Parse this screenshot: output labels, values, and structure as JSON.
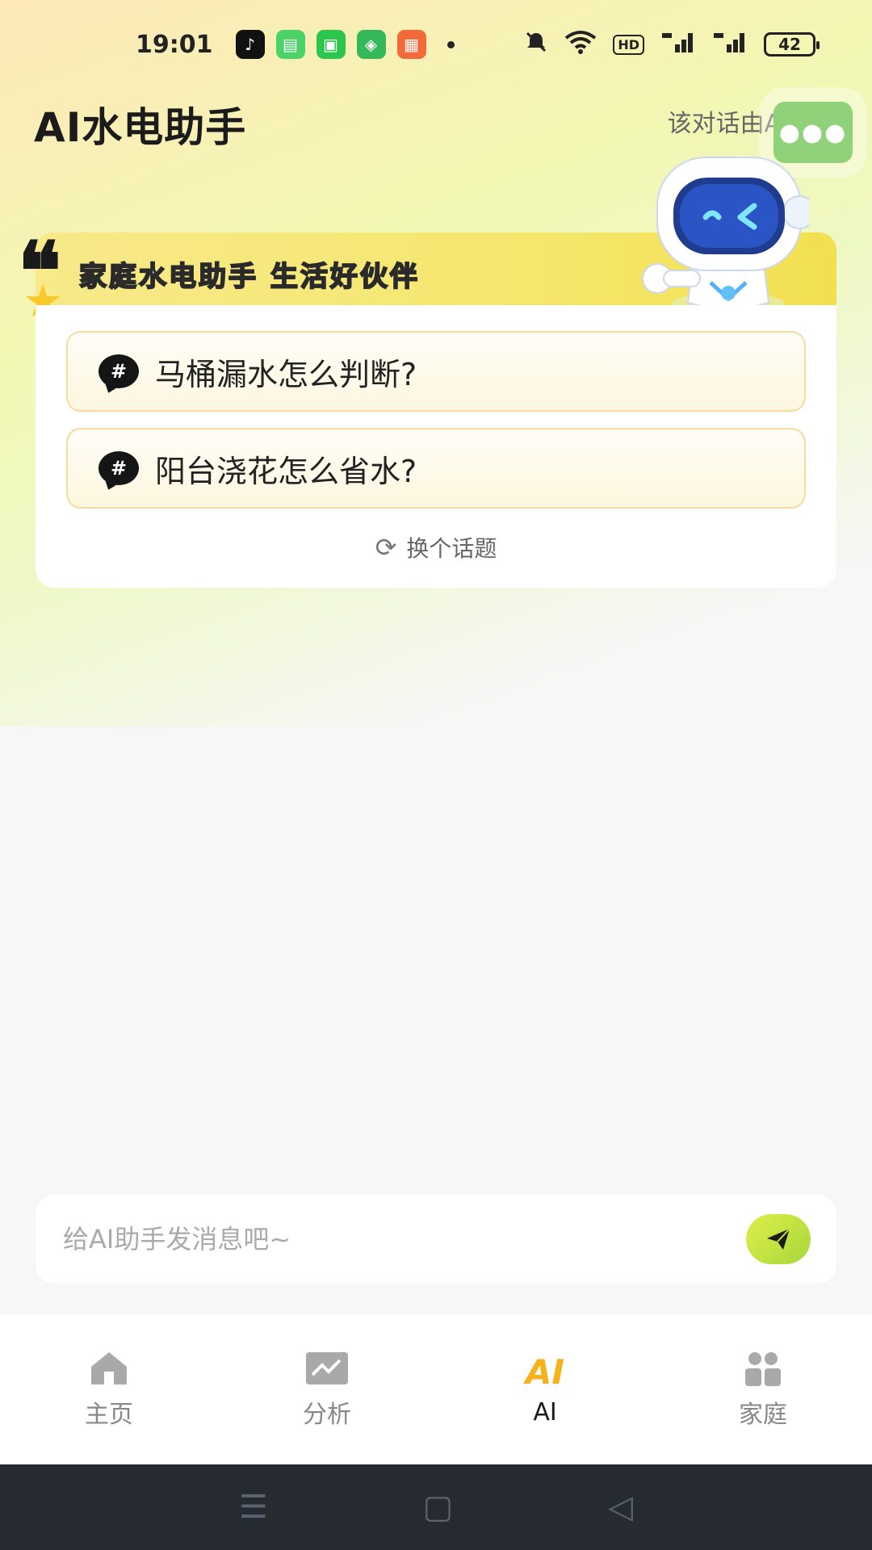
{
  "status_bar": {
    "time": "19:01",
    "battery": "42",
    "hd_label": "HD"
  },
  "header": {
    "title": "AI水电助手",
    "ai_note": "该对话由AI生成",
    "more_icon": "ellipsis-icon"
  },
  "banner": {
    "text": "家庭水电助手 生活好伙伴"
  },
  "topics": {
    "items": [
      {
        "label": "马桶漏水怎么判断?"
      },
      {
        "label": "阳台浇花怎么省水?"
      }
    ],
    "refresh_label": "换个话题"
  },
  "chat": {
    "placeholder": "给AI助手发消息吧~"
  },
  "tabs": [
    {
      "label": "主页",
      "icon": "home-icon",
      "active": false
    },
    {
      "label": "分析",
      "icon": "chart-icon",
      "active": false
    },
    {
      "label": "AI",
      "icon": "ai-icon",
      "active": true
    },
    {
      "label": "家庭",
      "icon": "family-icon",
      "active": false
    }
  ],
  "colors": {
    "accent": "#f6b21a",
    "send_button": "#c9e23f",
    "banner": "#f5e76e"
  }
}
